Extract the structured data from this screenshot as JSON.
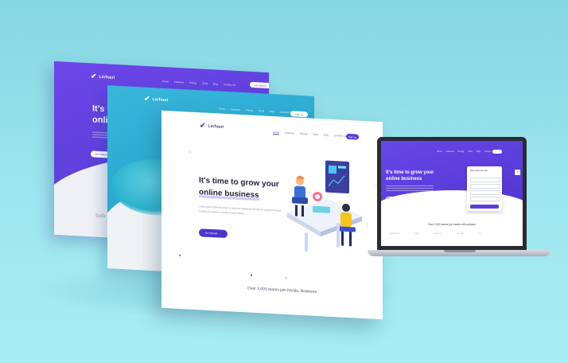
{
  "brand": {
    "name": "LinTouri"
  },
  "card_purple": {
    "nav": [
      "Home",
      "Features",
      "Pricing",
      "Tools",
      "Blog",
      "Contact Us"
    ],
    "button": "Get Started",
    "headline_1": "It's ti",
    "headline_2": "onlin",
    "cta": "Get Started",
    "tail": "bab"
  },
  "card_teal": {
    "nav": [
      "Home",
      "Features",
      "Pricing",
      "Tools",
      "Blog",
      "Contact Us"
    ],
    "button": "Sign up"
  },
  "card_white": {
    "nav": [
      "Home",
      "Features",
      "Pricing",
      "Tools",
      "Blog",
      "Contact Us"
    ],
    "button": "Sign up",
    "headline_1": "It's time to grow your",
    "headline_2": "online business",
    "paragraph": "Lorem ipsum dolor sit amet consectetur adipiscing elit sed do eiusmod tempor incididunt ut labore et dolore magna aliqua.",
    "cta": "Get Started",
    "footer": "Over 2,000 teams join hands, Business"
  },
  "laptop": {
    "nav": [
      "Home",
      "Features",
      "Pricing",
      "Tools",
      "Blog",
      "Contact"
    ],
    "headline_1": "It's time to grow your",
    "headline_2": "online business",
    "form_title": "Start your Free trial",
    "partners_text": "Over 2,000 teams join hands with partners",
    "logos": [
      "Instagram",
      "slack",
      "Amazon",
      "Google",
      "fb"
    ]
  },
  "colors": {
    "purple": "#5b3fd9",
    "teal": "#27a6cf",
    "background": "#9ee6ef"
  }
}
